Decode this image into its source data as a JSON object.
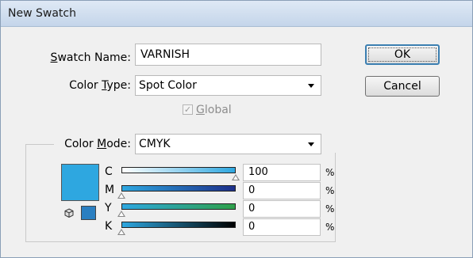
{
  "window": {
    "title": "New Swatch"
  },
  "swatch_name": {
    "label_pre": "",
    "label_u": "S",
    "label_post": "watch Name:",
    "value": "VARNISH"
  },
  "color_type": {
    "label_pre": "Color ",
    "label_u": "T",
    "label_post": "ype:",
    "value": "Spot Color"
  },
  "global": {
    "label_u": "G",
    "label_post": "lobal",
    "checked": true,
    "checkmark": "✓"
  },
  "color_mode": {
    "label_pre": "Color ",
    "label_u": "M",
    "label_post": "ode:",
    "value": "CMYK"
  },
  "buttons": {
    "ok": "OK",
    "cancel": "Cancel"
  },
  "channels": [
    {
      "name": "C",
      "value": "100",
      "unit": "%",
      "level": 1.0,
      "gradient": [
        "#ffffff",
        "#2ea7e0"
      ]
    },
    {
      "name": "M",
      "value": "0",
      "unit": "%",
      "level": 0.0,
      "gradient": [
        "#2ea7e0",
        "#1d2f8a"
      ]
    },
    {
      "name": "Y",
      "value": "0",
      "unit": "%",
      "level": 0.0,
      "gradient": [
        "#2ea7e0",
        "#2fa14a"
      ]
    },
    {
      "name": "K",
      "value": "0",
      "unit": "%",
      "level": 0.0,
      "gradient": [
        "#2ea7e0",
        "#000000"
      ]
    }
  ],
  "preview_color": "#2ea7e0",
  "icons": {
    "gamut": "cube-icon",
    "web_safe": "small-swatch-icon"
  }
}
